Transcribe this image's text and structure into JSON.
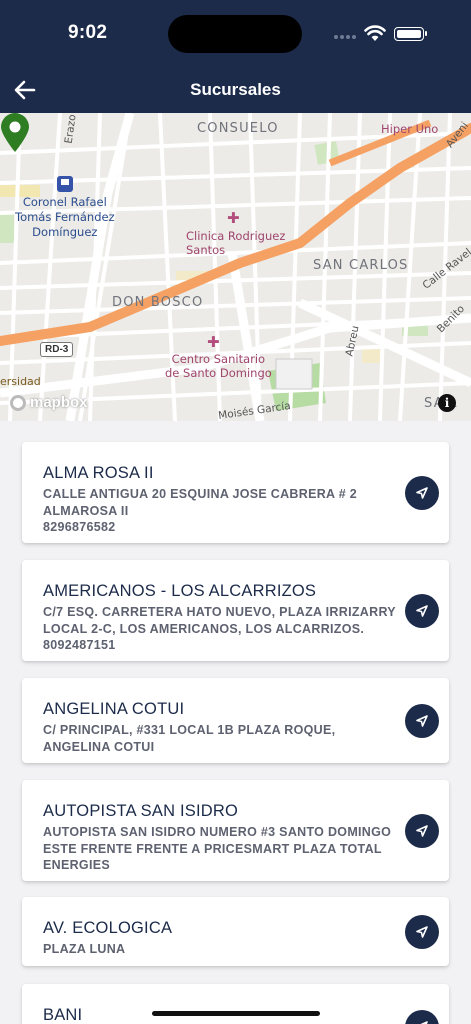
{
  "status_bar": {
    "time": "9:02"
  },
  "header": {
    "title": "Sucursales",
    "back_icon": "arrow-left-icon"
  },
  "map": {
    "labels": {
      "consuelo": "CONSUELO",
      "hiper_uno": "Hiper Uno",
      "avenida": "Aveni",
      "erazo": "Erazo",
      "coronel": "Coronel Rafael\nTomás Fernández\nDomínguez",
      "clinica": "Clinica Rodriguez\nSantos",
      "san_carlos": "SAN CARLOS",
      "calle_ravelo": "Calle Ravel",
      "benito": "Benito",
      "don_bosco": "DON BOSCO",
      "centro": "Centro Sanitario\nde Santo Domingo",
      "abreu": "Abreu",
      "universidad": "ersidad",
      "moises": "Moisés García",
      "sal": "SA L",
      "rd3": "RD-3",
      "mapbox": "mapbox",
      "info": "i"
    }
  },
  "branches": [
    {
      "name": "ALMA ROSA II",
      "address": "CALLE ANTIGUA 20 ESQUINA JOSE CABRERA # 2 ALMAROSA II\n8296876582"
    },
    {
      "name": "AMERICANOS - LOS ALCARRIZOS",
      "address": "C/7 ESQ. CARRETERA HATO NUEVO, PLAZA IRRIZARRY LOCAL 2-C, LOS AMERICANOS, LOS ALCARRIZOS.\n8092487151"
    },
    {
      "name": "ANGELINA COTUI",
      "address": "C/ PRINCIPAL, #331 LOCAL 1B PLAZA ROQUE, ANGELINA COTUI"
    },
    {
      "name": "AUTOPISTA SAN ISIDRO",
      "address": "AUTOPISTA SAN ISIDRO NUMERO #3 SANTO DOMINGO ESTE FRENTE FRENTE A PRICESMART PLAZA TOTAL ENERGIES"
    },
    {
      "name": "AV. ECOLOGICA",
      "address": "PLAZA LUNA"
    },
    {
      "name": "BANI",
      "address": ""
    }
  ],
  "colors": {
    "header": "#1c2b4a",
    "pin": "#2e7d23",
    "highway": "#f5a163"
  }
}
